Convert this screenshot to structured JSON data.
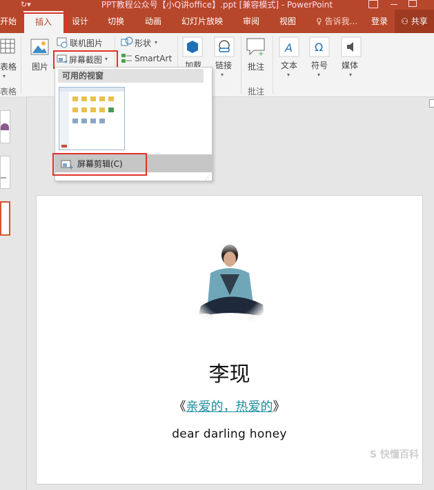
{
  "window": {
    "title": "PPT教程公众号【小Q讲office】.ppt [兼容模式] - PowerPoint"
  },
  "tabs": [
    "开始",
    "插入",
    "设计",
    "切换",
    "动画",
    "幻灯片放映",
    "审阅",
    "视图"
  ],
  "tell_me": "告诉我...",
  "login": "登录",
  "share": "共享",
  "ribbon": {
    "table_label": "表格",
    "table_group_label": "表格",
    "picture_label": "图片",
    "online_picture_label": "联机图片",
    "screenshot_label": "屏幕截图",
    "shapes_label": "形状",
    "smartart_label": "SmartArt",
    "addins_label": "加载",
    "link_label": "链接",
    "comment_label": "批注",
    "comment_group_label": "批注",
    "text_label": "文本",
    "symbol_label": "符号",
    "media_label": "媒体"
  },
  "dropdown": {
    "header": "可用的视窗",
    "clip_label": "屏幕剪辑(C)"
  },
  "slide": {
    "name": "李现",
    "song_open": "《",
    "song_title": "亲爱的，热爱的",
    "song_close": "》",
    "subtitle": "dear darling honey"
  },
  "watermark": "S 快懂百科",
  "colors": {
    "accent": "#b7472a",
    "highlight_box": "#e0312b",
    "link": "#1a8ca0"
  }
}
